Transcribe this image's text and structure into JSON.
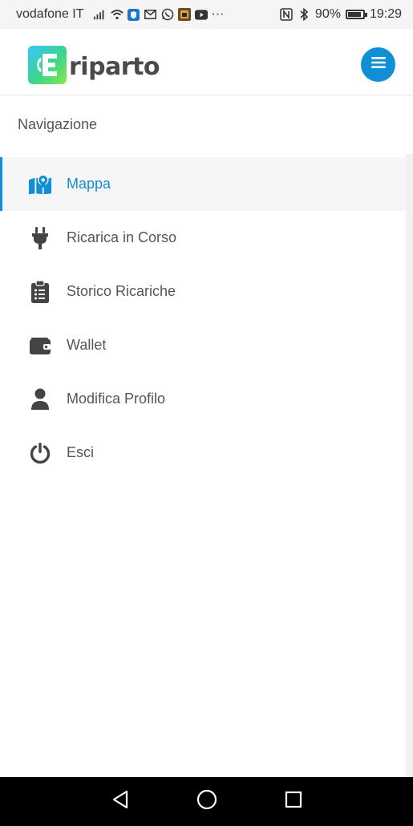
{
  "status_bar": {
    "carrier": "vodafone IT",
    "extra": "···",
    "battery": "90%",
    "time": "19:29",
    "battery_level": 0.9
  },
  "header": {
    "logo_text": "riparto",
    "brand_color": "#0f8fd6",
    "menu_icon": "hamburger-icon"
  },
  "navigation": {
    "title": "Navigazione",
    "items": [
      {
        "label": "Mappa",
        "icon": "map-pin-icon",
        "active": true
      },
      {
        "label": "Ricarica in Corso",
        "icon": "plug-icon",
        "active": false
      },
      {
        "label": "Storico Ricariche",
        "icon": "clipboard-list-icon",
        "active": false
      },
      {
        "label": "Wallet",
        "icon": "wallet-icon",
        "active": false
      },
      {
        "label": "Modifica Profilo",
        "icon": "user-icon",
        "active": false
      },
      {
        "label": "Esci",
        "icon": "power-icon",
        "active": false
      }
    ]
  },
  "system_nav": {
    "back": "back-triangle-icon",
    "home": "home-circle-icon",
    "recents": "recents-square-icon"
  }
}
